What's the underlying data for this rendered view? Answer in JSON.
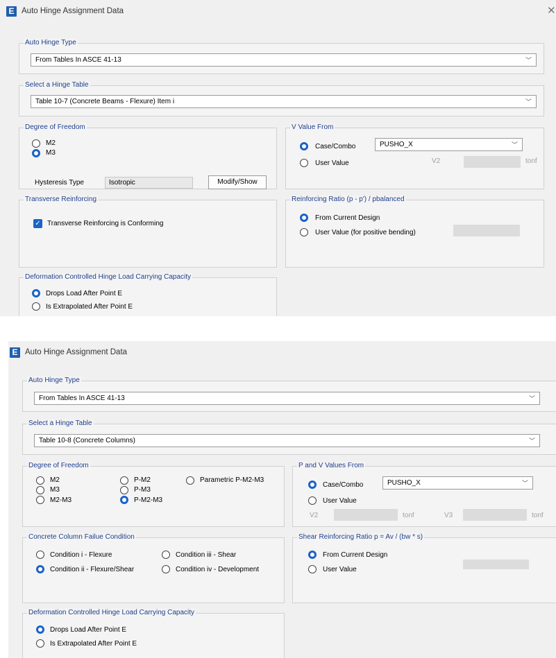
{
  "dialog1": {
    "window_title": "Auto Hinge Assignment Data",
    "close_glyph": "✕",
    "auto_hinge_type": {
      "legend": "Auto Hinge Type",
      "value": "From Tables In ASCE 41-13"
    },
    "hinge_table": {
      "legend": "Select a Hinge Table",
      "value": "Table 10-7 (Concrete Beams - Flexure) Item i"
    },
    "dof": {
      "legend": "Degree of Freedom",
      "m2": "M2",
      "m3": "M3",
      "selected": "M3",
      "hysteresis_label": "Hysteresis Type",
      "hysteresis_value": "Isotropic",
      "modify_button": "Modify/Show"
    },
    "v_value": {
      "legend": "V Value From",
      "case_combo": "Case/Combo",
      "case_value": "PUSHO_X",
      "user_value": "User Value",
      "v2": "V2",
      "unit": "tonf",
      "selected": "Case/Combo"
    },
    "transverse": {
      "legend": "Transverse Reinforcing",
      "checkbox_label": "Transverse Reinforcing is Conforming",
      "checked": true
    },
    "reinf_ratio": {
      "legend": "Reinforcing Ratio  (p - p') / pbalanced",
      "from_design": "From Current Design",
      "user_value": "User Value (for positive bending)",
      "selected": "From Current Design"
    },
    "deformation": {
      "legend": "Deformation Controlled Hinge Load Carrying Capacity",
      "drops": "Drops Load After Point E",
      "extrapolated": "Is Extrapolated After Point E",
      "selected": "Drops"
    }
  },
  "dialog2": {
    "window_title": "Auto Hinge Assignment Data",
    "auto_hinge_type": {
      "legend": "Auto Hinge Type",
      "value": "From Tables In ASCE 41-13"
    },
    "hinge_table": {
      "legend": "Select a Hinge Table",
      "value": "Table 10-8 (Concrete Columns)"
    },
    "dof": {
      "legend": "Degree of Freedom",
      "m2": "M2",
      "m3": "M3",
      "m2m3": "M2-M3",
      "pm2": "P-M2",
      "pm3": "P-M3",
      "pm2m3": "P-M2-M3",
      "parametric": "Parametric P-M2-M3",
      "selected": "P-M2-M3"
    },
    "pv_values": {
      "legend": "P and V Values From",
      "case_combo": "Case/Combo",
      "case_value": "PUSHO_X",
      "user_value": "User Value",
      "v2": "V2",
      "v3": "V3",
      "unit": "tonf",
      "selected": "Case/Combo"
    },
    "failure": {
      "legend": "Concrete Column Failue Condition",
      "cond1": "Condition i -  Flexure",
      "cond2": "Condition ii -  Flexure/Shear",
      "cond3": "Condition iii -  Shear",
      "cond4": "Condition iv -  Development",
      "selected": "cond2"
    },
    "shear_ratio": {
      "legend": "Shear Reinforcing Ratio p = Av / (bw * s)",
      "from_design": "From Current Design",
      "user_value": "User Value",
      "selected": "From Current Design"
    },
    "deformation": {
      "legend": "Deformation Controlled Hinge Load Carrying Capacity",
      "drops": "Drops Load After Point E",
      "extrapolated": "Is Extrapolated After Point E",
      "selected": "Drops"
    }
  },
  "icons": {
    "app_icon": "E",
    "chevron": "﹀",
    "check": "✓"
  }
}
